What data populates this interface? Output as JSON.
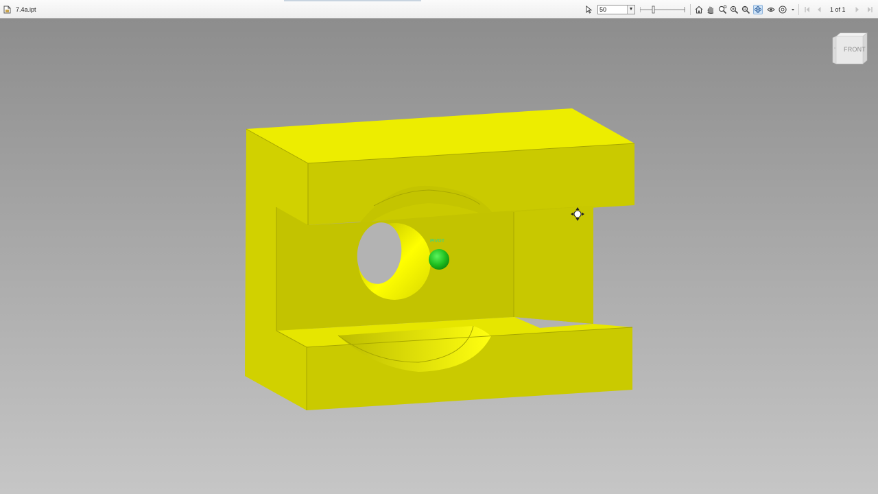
{
  "window": {
    "title": "7.4a.ipt"
  },
  "toolbar": {
    "zoom_value": "50",
    "page_indicator": "1 of 1",
    "icons": [
      "select-arrow-icon",
      "zoom-dropdown",
      "zoom-slider",
      "home-view-icon",
      "pan-icon",
      "zoom-window-icon",
      "zoom-icon",
      "zoom-all-icon",
      "orbit-icon",
      "look-at-icon",
      "steering-wheel-icon",
      "first-page-icon",
      "previous-page-icon",
      "next-page-icon",
      "last-page-icon"
    ]
  },
  "viewport": {
    "viewcube_label": "FRONT",
    "pivot_label": "PIVOT",
    "colors": {
      "part_top": "#eeee00",
      "part_front": "#c8c800",
      "part_side": "#d4d400",
      "background_top": "#8d8d8d",
      "background_bottom": "#c6c6c6",
      "pivot": "#22b422"
    }
  }
}
